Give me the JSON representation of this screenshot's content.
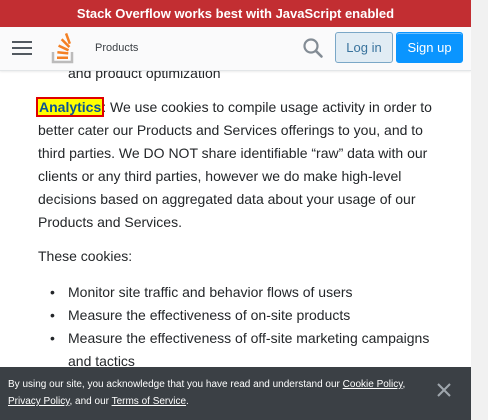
{
  "banner": {
    "text": "Stack Overflow works best with JavaScript enabled"
  },
  "topbar": {
    "menu_icon": "hamburger-icon",
    "logo_icon": "stackoverflow-logo",
    "products_label": "Products",
    "search_icon": "search-icon",
    "login_label": "Log in",
    "signup_label": "Sign up"
  },
  "content": {
    "partial_item": "and product optimization",
    "analytics_term": "Analytics",
    "analytics_colon": ":",
    "analytics_text": " We use cookies to compile usage activity in order to better cater our Products and Services offerings to you, and to third parties. We DO NOT share identifiable “raw” data with our clients or any third parties, however we do make high-level decisions based on aggregated data about your usage of our Products and Services.",
    "these_cookies": "These cookies:",
    "items": [
      "Monitor site traffic and behavior flows of users",
      "Measure the effectiveness of on-site products",
      "Measure the effectiveness of off-site marketing campaigns and tactics"
    ]
  },
  "cookie_notice": {
    "text_before": "By using our site, you acknowledge that you have read and understand our ",
    "cookie_policy": "Cookie Policy",
    "sep1": ", ",
    "privacy_policy": "Privacy Policy",
    "sep2": ", and our ",
    "terms": "Terms of Service",
    "end": ".",
    "close_icon": "close-icon"
  },
  "colors": {
    "banner_bg": "#c22e32",
    "signup_bg": "#0a95ff",
    "login_bg": "#e1ecf4",
    "highlight_bg": "#ffff00",
    "highlight_border": "#e00000",
    "cookie_bg": "#3b4045"
  }
}
